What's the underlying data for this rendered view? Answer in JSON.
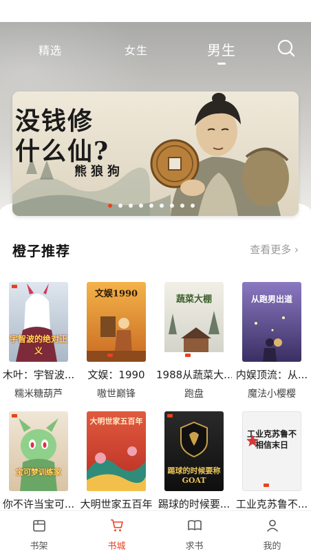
{
  "header": {
    "tabs": [
      {
        "label": "精选",
        "active": false
      },
      {
        "label": "女生",
        "active": false
      },
      {
        "label": "男生",
        "active": true
      }
    ],
    "search_icon": "search-icon"
  },
  "banner": {
    "title_line1": "没钱修",
    "title_line2": "什么仙?",
    "author": "熊狼狗",
    "slide_count": 9,
    "active_slide": 0
  },
  "recommend": {
    "title": "橙子推荐",
    "more_label": "查看更多 ›",
    "books": [
      {
        "title": "木叶：宇智波...",
        "author": "糯米糖葫芦",
        "cover_text": "宇智波的绝对正义",
        "cover_color": "#c9d4df"
      },
      {
        "title": "文娱：1990",
        "author": "嗷世巅锋",
        "cover_text": "文娱1990",
        "cover_color": "#e8a23c"
      },
      {
        "title": "1988从蔬菜大...",
        "author": "跑盘",
        "cover_text": "蔬菜大棚",
        "cover_color": "#d8d6cc"
      },
      {
        "title": "内娱顶流：从...",
        "author": "魔法小樱樱",
        "cover_text": "从跑男出道",
        "cover_color": "#6b5aa0"
      },
      {
        "title": "你不许当宝可...",
        "author": "",
        "cover_text": "宝可梦训练家",
        "cover_color": "#e6d9c6"
      },
      {
        "title": "大明世家五百年",
        "author": "",
        "cover_text": "大明世家五百年",
        "cover_color": "#d7432e"
      },
      {
        "title": "踢球的时候要...",
        "author": "",
        "cover_text": "踢球的时候要称GOAT",
        "cover_color": "#1b1b1b"
      },
      {
        "title": "工业克苏鲁不...",
        "author": "",
        "cover_text": "工业克苏鲁不相信末日",
        "cover_color": "#f2f2f2"
      }
    ]
  },
  "bottom_nav": [
    {
      "label": "书架",
      "icon": "bookshelf-icon",
      "active": false
    },
    {
      "label": "书城",
      "icon": "cart-icon",
      "active": true
    },
    {
      "label": "求书",
      "icon": "open-book-icon",
      "active": false
    },
    {
      "label": "我的",
      "icon": "user-icon",
      "active": false
    }
  ],
  "colors": {
    "accent": "#e8421f",
    "muted": "#9a9a9a"
  }
}
